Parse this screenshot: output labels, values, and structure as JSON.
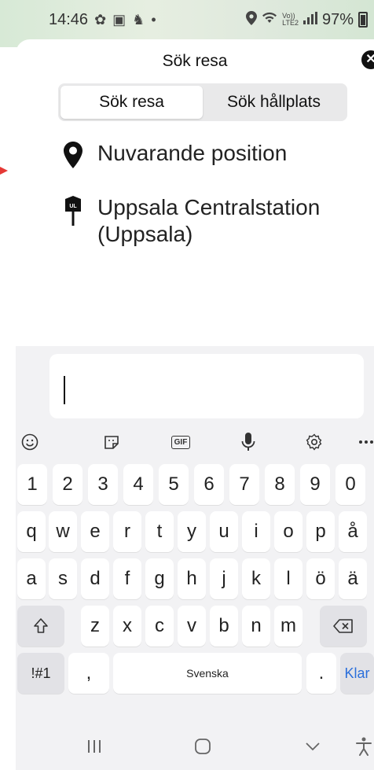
{
  "status_bar": {
    "time": "14:46",
    "battery": "97%",
    "network": "VoLTE2"
  },
  "sheet": {
    "title": "Sök resa",
    "tabs": [
      {
        "label": "Sök resa",
        "active": true
      },
      {
        "label": "Sök hållplats",
        "active": false
      }
    ],
    "places": [
      {
        "label": "Nuvarande position",
        "icon": "location-pin-icon"
      },
      {
        "label": "Uppsala Centralstation (Uppsala)",
        "icon": "ul-stop-sign-icon"
      }
    ]
  },
  "search": {
    "value": ""
  },
  "keyboard": {
    "toolbar": [
      "emoji-icon",
      "sticker-icon",
      "gif-icon",
      "mic-icon",
      "settings-icon",
      "more-icon"
    ],
    "gif_label": "GIF",
    "rows": {
      "numbers": [
        "1",
        "2",
        "3",
        "4",
        "5",
        "6",
        "7",
        "8",
        "9",
        "0"
      ],
      "row1": [
        "q",
        "w",
        "e",
        "r",
        "t",
        "y",
        "u",
        "i",
        "o",
        "p",
        "å"
      ],
      "row2": [
        "a",
        "s",
        "d",
        "f",
        "g",
        "h",
        "j",
        "k",
        "l",
        "ö",
        "ä"
      ],
      "row3": [
        "z",
        "x",
        "c",
        "v",
        "b",
        "n",
        "m"
      ]
    },
    "symbols_label": "!#1",
    "comma_label": ",",
    "space_label": "Svenska",
    "period_label": ".",
    "enter_label": "Klar"
  },
  "colors": {
    "accent": "#2b6fdb",
    "keyboard_bg": "#f2f2f4",
    "segment_bg": "#e9e9ea"
  }
}
